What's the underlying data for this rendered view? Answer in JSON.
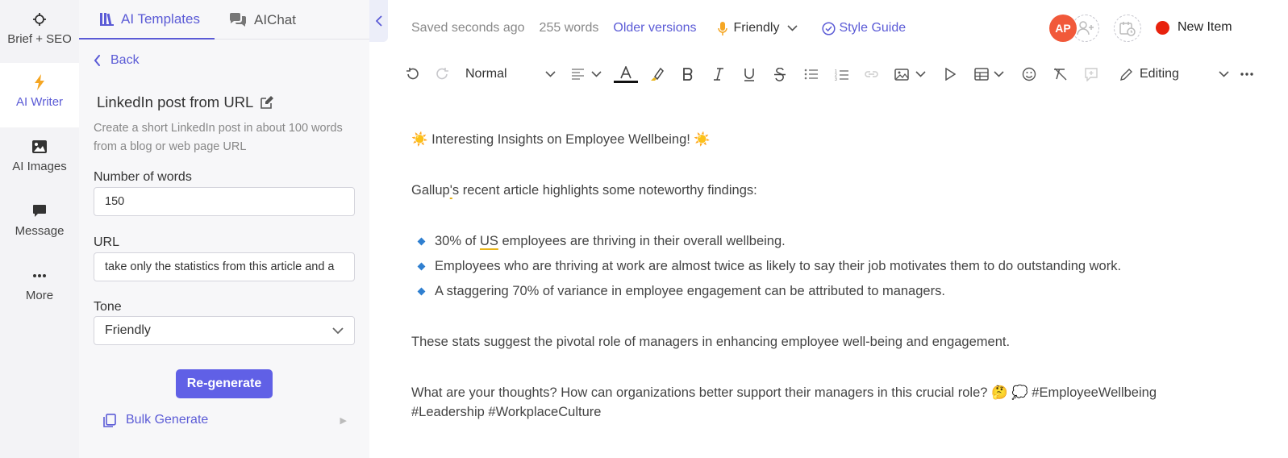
{
  "rail": {
    "items": [
      {
        "label": "Brief + SEO",
        "icon": "crosshair-icon"
      },
      {
        "label": "AI Writer",
        "icon": "lightning-icon"
      },
      {
        "label": "AI Images",
        "icon": "image-icon"
      },
      {
        "label": "Message",
        "icon": "chat-bubble-icon"
      },
      {
        "label": "More",
        "icon": "ellipsis-icon"
      }
    ]
  },
  "panel": {
    "tabs": [
      "AI Templates",
      "AIChat"
    ],
    "back_label": "Back",
    "template_title": "LinkedIn post from URL",
    "template_desc": "Create a short LinkedIn post in about 100 words from a blog or web page URL",
    "words_label": "Number of words",
    "words_value": "150",
    "url_label": "URL",
    "url_value": "take only the statistics from this article and a",
    "tone_label": "Tone",
    "tone_value": "Friendly",
    "regenerate_label": "Re-generate",
    "bulk_label": "Bulk Generate"
  },
  "topbar": {
    "saved": "Saved seconds ago",
    "words": "255 words",
    "older": "Older versions",
    "tone": "Friendly",
    "style_guide": "Style Guide",
    "avatar_initials": "AP",
    "status": "New Item",
    "status_color": "#e8220d"
  },
  "toolbar": {
    "paragraph_style": "Normal",
    "mode": "Editing"
  },
  "content": {
    "heading": "☀️ Interesting Insights on Employee Wellbeing! ☀️",
    "intro_a": "Gallup",
    "intro_b": "'",
    "intro_c": "s recent article highlights some noteworthy findings:",
    "b1_a": "30% of ",
    "b1_b": "US",
    "b1_c": " employees are thriving in their overall wellbeing.",
    "b2": "Employees who are thriving at work are almost twice as likely to say their job motivates them to do outstanding work.",
    "b3": "A staggering 70% of variance in employee engagement can be attributed to managers.",
    "p2": "These stats suggest the pivotal role of managers in enhancing employee well-being and engagement.",
    "p3_line1": "What are your thoughts? How can organizations better support their managers in this crucial role? 🤔 💭 #EmployeeWellbeing",
    "p3_line2": "#Leadership #WorkplaceCulture"
  }
}
